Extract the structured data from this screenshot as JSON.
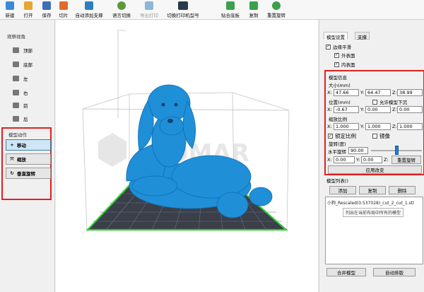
{
  "toolbar": {
    "items": [
      {
        "label": "新建",
        "icon": "new-file-icon",
        "color": "#3b8ad9",
        "enabled": true
      },
      {
        "label": "打开",
        "icon": "open-folder-icon",
        "color": "#e8a530",
        "enabled": true
      },
      {
        "label": "保存",
        "icon": "save-icon",
        "color": "#3b6fb6",
        "enabled": true
      },
      {
        "label": "切片",
        "icon": "slice-icon",
        "color": "#e06b2b",
        "enabled": true
      },
      {
        "label": "自动添加支撑",
        "icon": "support-icon",
        "color": "#2e7ebf",
        "enabled": true
      },
      {
        "label": "语言切换",
        "icon": "language-icon",
        "color": "#5a9a3a",
        "enabled": true
      },
      {
        "label": "导出打印",
        "icon": "export-print-icon",
        "color": "#8db6d8",
        "enabled": false
      },
      {
        "label": "切换打印机型号",
        "icon": "printer-switch-icon",
        "color": "#2a3a4a",
        "enabled": true
      },
      {
        "label": "贴合底板",
        "icon": "lay-flat-icon",
        "color": "#3aa14a",
        "enabled": true
      },
      {
        "label": "复制",
        "icon": "copy-icon",
        "color": "#3aa14a",
        "enabled": true
      },
      {
        "label": "重置旋转",
        "icon": "reset-rotation-icon",
        "color": "#3aa14a",
        "enabled": true
      }
    ]
  },
  "left": {
    "view_title": "观察视角",
    "views": [
      {
        "label": "顶部",
        "icon": "view-top-icon"
      },
      {
        "label": "底部",
        "icon": "view-bottom-icon"
      },
      {
        "label": "左",
        "icon": "view-left-icon"
      },
      {
        "label": "右",
        "icon": "view-right-icon"
      },
      {
        "label": "前",
        "icon": "view-front-icon"
      },
      {
        "label": "后",
        "icon": "view-back-icon"
      }
    ],
    "motion_title": "模型动作",
    "motions": [
      {
        "label": "移动",
        "icon": "move-icon",
        "glyph": "+",
        "active": true
      },
      {
        "label": "缩放",
        "icon": "scale-icon",
        "glyph": "⤧",
        "active": false
      },
      {
        "label": "垂直旋转",
        "icon": "rotate-icon",
        "glyph": "↻",
        "active": false
      }
    ]
  },
  "viewport": {
    "watermark": "ALOMAR",
    "model_color": "#1f8fd8",
    "plate_color": "#3a3f4a",
    "plate_edge": "#33cc33"
  },
  "right": {
    "tabs": [
      "模型设置",
      "支撑"
    ],
    "edge_smooth": "边缘平滑",
    "outer_surface": "外表面",
    "inner_surface": "内表面",
    "info_title": "模型信息",
    "size_label": "大小(mm)",
    "size": {
      "x": "47.66",
      "y": "64.47",
      "z": "38.99"
    },
    "pos_label": "位置(mm)",
    "allow_sink": "允许模型下沉",
    "pos": {
      "x": "-0.67",
      "y": "0.00",
      "z": "0.00"
    },
    "scale_label": "缩放比例",
    "scale": {
      "x": "1.000",
      "y": "1.000",
      "z": "1.000"
    },
    "lock_ratio": "锁定比例",
    "mirror": "镜像",
    "rotate_label": "旋转(度)",
    "h_rotate_label": "水平旋转",
    "h_rotate_value": "90.00",
    "h_rotate_fraction": 0.5,
    "rot": {
      "x": "0.00",
      "y": "0.00",
      "z": "0.00"
    },
    "reset_rotate": "重置旋转",
    "apply": "应用改变",
    "list_title": "模型列表()",
    "add": "添加",
    "copy": "复制",
    "delete": "删除",
    "list_item": "小狗_Rescaled(0.537028)_cut_2_cut_1.stl",
    "list_hint": "列出在当前布局中所有的模型",
    "merge": "合并模型",
    "auto_layout": "自动排版",
    "axis": {
      "x": "X:",
      "y": "Y:",
      "z": "Z:"
    }
  }
}
